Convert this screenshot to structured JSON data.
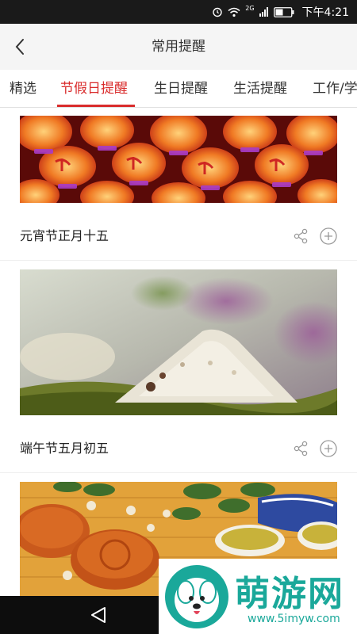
{
  "status_bar": {
    "time": "下午4:21",
    "network": "2G",
    "battery": "battery-icon",
    "colors": {
      "bg": "#1a1a1a",
      "fg": "#ffffff"
    }
  },
  "header": {
    "title": "常用提醒",
    "back_icon": "chevron-left-icon"
  },
  "tabs": [
    {
      "label": "精选",
      "active": false
    },
    {
      "label": "节假日提醒",
      "active": true
    },
    {
      "label": "生日提醒",
      "active": false
    },
    {
      "label": "生活提醒",
      "active": false
    },
    {
      "label": "工作/学",
      "active": false
    }
  ],
  "accent_color": "#d92c2c",
  "cards": [
    {
      "title": "元宵节正月十五",
      "image": "red-lanterns",
      "share_icon": "share-icon",
      "add_icon": "plus-circle-icon"
    },
    {
      "title": "端午节五月初五",
      "image": "zongzi-rice-dumpling",
      "share_icon": "share-icon",
      "add_icon": "plus-circle-icon"
    },
    {
      "title": "",
      "image": "mooncakes-and-tea"
    }
  ],
  "nav_bar": {
    "back_icon": "triangle-back-icon"
  },
  "watermark": {
    "text": "萌游网",
    "url": "www.5imyw.com",
    "color": "#1aa89a"
  }
}
